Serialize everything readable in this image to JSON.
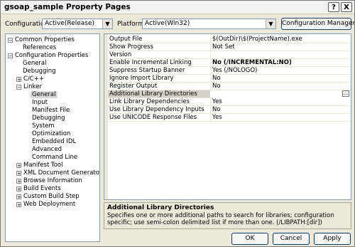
{
  "title": "gsoap_sample Property Pages",
  "config_label": "Configuration:",
  "config_value": "Active(Release)",
  "platform_label": "Platform:",
  "platform_value": "Active(Win32)",
  "config_manager_btn": "Configuration Manager...",
  "tree": {
    "common_properties": "Common Properties",
    "references": "References",
    "configuration_properties": "Configuration Properties",
    "general": "General",
    "debugging": "Debugging",
    "cpp": "C/C++",
    "linker": "Linker",
    "linker_children": [
      "General",
      "Input",
      "Manifest File",
      "Debugging",
      "System",
      "Optimization",
      "Embedded IDL",
      "Advanced",
      "Command Line"
    ],
    "after": [
      "Manifest Tool",
      "XML Document Generator",
      "Browse Information",
      "Build Events",
      "Custom Build Step",
      "Web Deployment"
    ]
  },
  "grid_rows": [
    {
      "name": "Output File",
      "value": "$(OutDir)\\$(ProjectName).exe"
    },
    {
      "name": "Show Progress",
      "value": "Not Set"
    },
    {
      "name": "Version",
      "value": ""
    },
    {
      "name": "Enable Incremental Linking",
      "value": "No (/INCREMENTAL:NO)"
    },
    {
      "name": "Suppress Startup Banner",
      "value": "Yes (/NOLOGO)"
    },
    {
      "name": "Ignore Import Library",
      "value": "No"
    },
    {
      "name": "Register Output",
      "value": "No"
    },
    {
      "name": "Additional Library Directories",
      "value": ""
    },
    {
      "name": "Link Library Dependencies",
      "value": "Yes"
    },
    {
      "name": "Use Library Dependency Inputs",
      "value": "No"
    },
    {
      "name": "Use UNICODE Response Files",
      "value": "Yes"
    }
  ],
  "description": {
    "title": "Additional Library Directories",
    "text": "Specifies one or more additional paths to search for libraries; configuration specific; use semi-colon delimited list if more than one.     (/LIBPATH:[dir])"
  },
  "buttons": {
    "ok": "OK",
    "cancel": "Cancel",
    "apply": "Apply"
  },
  "titlebar": {
    "help": "?",
    "close": "X"
  }
}
